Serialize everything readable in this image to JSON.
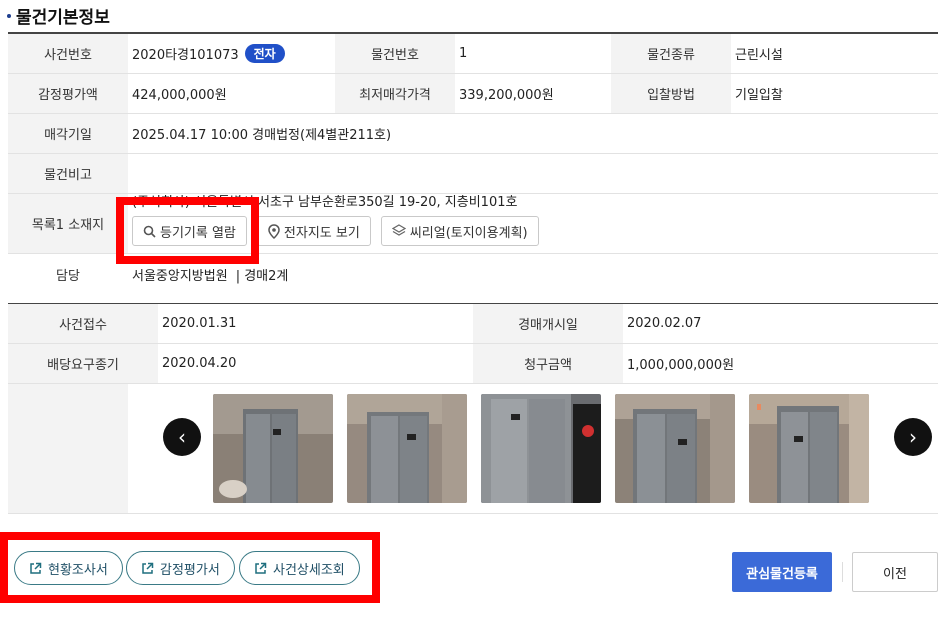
{
  "section": {
    "title": "물건기본정보"
  },
  "info": {
    "case_no_label": "사건번호",
    "case_no": "2020타경101073",
    "case_badge": "전자",
    "item_no_label": "물건번호",
    "item_no": "1",
    "item_type_label": "물건종류",
    "item_type": "근린시설",
    "appraisal_label": "감정평가액",
    "appraisal": "424,000,000원",
    "min_price_label": "최저매각가격",
    "min_price": "339,200,000원",
    "bid_method_label": "입찰방법",
    "bid_method": "기일입찰",
    "sale_date_label": "매각기일",
    "sale_date": "2025.04.17 10:00 경매법정(제4별관211호)",
    "note_label": "물건비고",
    "note": "",
    "location_label": "목록1 소재지",
    "location_addr": "(주식회사) 서울특별시 서초구 남부순환로350길 19-20, 지층비101호",
    "btn_registry": "등기기록 열람",
    "btn_map": "전자지도 보기",
    "btn_landuse": "씨리얼(토지이용계획)",
    "manager_label": "담당",
    "manager_court": "서울중앙지방법원",
    "manager_dept": "| 경매2계"
  },
  "case": {
    "received_label": "사건접수",
    "received": "2020.01.31",
    "start_label": "경매개시일",
    "start": "2020.02.07",
    "deadline_label": "배당요구종기",
    "deadline": "2020.04.20",
    "claim_label": "청구금액",
    "claim": "1,000,000,000원"
  },
  "gallery": {
    "prev": "‹",
    "next": "›"
  },
  "actions": {
    "survey": "현황조사서",
    "appraisal_doc": "감정평가서",
    "case_detail": "사건상세조회",
    "favorite": "관심물건등록",
    "prev": "이전"
  },
  "colors": {
    "accent": "#3b6ad8",
    "badge": "#2050c8",
    "highlight": "#ff0000"
  }
}
